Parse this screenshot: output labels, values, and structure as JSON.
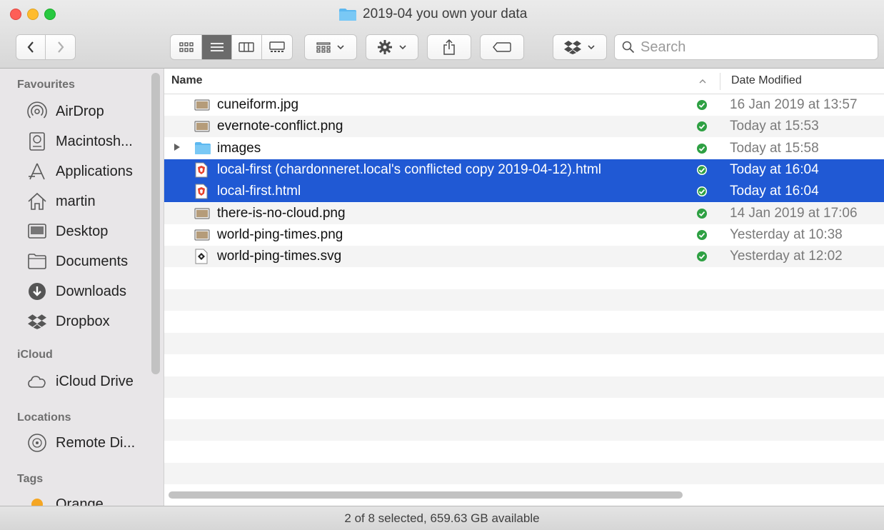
{
  "window": {
    "title": "2019-04 you own your data"
  },
  "toolbar": {
    "search_placeholder": "Search",
    "back_icon": "chevron-left-icon",
    "forward_icon": "chevron-right-icon",
    "view_modes": [
      "icon-view-icon",
      "list-view-icon",
      "column-view-icon",
      "gallery-view-icon"
    ],
    "active_view": "list",
    "accent": "#2059d4"
  },
  "sidebar": {
    "headings": {
      "favourites": "Favourites",
      "icloud": "iCloud",
      "locations": "Locations",
      "tags": "Tags"
    },
    "favourites": [
      {
        "label": "AirDrop",
        "icon": "airdrop-icon"
      },
      {
        "label": "Macintosh...",
        "icon": "hard-drive-icon"
      },
      {
        "label": "Applications",
        "icon": "applications-icon"
      },
      {
        "label": "martin",
        "icon": "home-icon"
      },
      {
        "label": "Desktop",
        "icon": "desktop-icon"
      },
      {
        "label": "Documents",
        "icon": "documents-folder-icon"
      },
      {
        "label": "Downloads",
        "icon": "downloads-icon"
      },
      {
        "label": "Dropbox",
        "icon": "dropbox-icon"
      }
    ],
    "icloud": [
      {
        "label": "iCloud Drive",
        "icon": "cloud-icon"
      }
    ],
    "locations": [
      {
        "label": "Remote Di...",
        "icon": "remote-disc-icon"
      }
    ],
    "tags": [
      {
        "label": "Orange",
        "color": "#f5a623"
      }
    ]
  },
  "list": {
    "columns": {
      "name": "Name",
      "date": "Date Modified"
    },
    "rows": [
      {
        "name": "cuneiform.jpg",
        "date": "16 Jan 2019 at 13:57",
        "icon": "image-file-icon",
        "selected": false,
        "folder": false
      },
      {
        "name": "evernote-conflict.png",
        "date": "Today at 15:53",
        "icon": "image-file-icon",
        "selected": false,
        "folder": false
      },
      {
        "name": "images",
        "date": "Today at 15:58",
        "icon": "folder-icon",
        "selected": false,
        "folder": true
      },
      {
        "name": "local-first (chardonneret.local's conflicted copy 2019-04-12).html",
        "date": "Today at 16:04",
        "icon": "brave-html-file-icon",
        "selected": true,
        "folder": false
      },
      {
        "name": "local-first.html",
        "date": "Today at 16:04",
        "icon": "brave-html-file-icon",
        "selected": true,
        "folder": false
      },
      {
        "name": "there-is-no-cloud.png",
        "date": "14 Jan 2019 at 17:06",
        "icon": "image-file-icon",
        "selected": false,
        "folder": false
      },
      {
        "name": "world-ping-times.png",
        "date": "Yesterday at 10:38",
        "icon": "image-file-icon",
        "selected": false,
        "folder": false
      },
      {
        "name": "world-ping-times.svg",
        "date": "Yesterday at 12:02",
        "icon": "svg-file-icon",
        "selected": false,
        "folder": false
      }
    ],
    "sync_status_color": "#2ea043"
  },
  "status": {
    "text": "2 of 8 selected, 659.63 GB available"
  }
}
